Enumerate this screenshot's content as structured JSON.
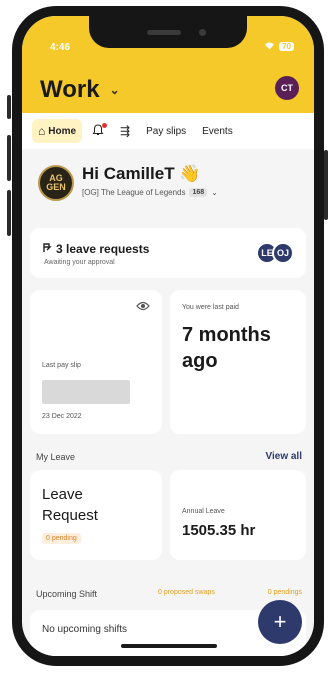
{
  "status": {
    "time": "4:46",
    "wifi": "wifi-icon",
    "battery": "70"
  },
  "header": {
    "workspace": "Work",
    "avatar_initials": "CT"
  },
  "tabs": [
    {
      "label": "Home",
      "icon": "home-icon"
    },
    {
      "label": "",
      "icon": "bell-icon"
    },
    {
      "label": "",
      "icon": "mention-icon"
    },
    {
      "label": "Pay slips",
      "icon": ""
    },
    {
      "label": "Events",
      "icon": ""
    }
  ],
  "greeting": {
    "hello": "Hi CamilleT",
    "emoji": "👋",
    "org_logo_text": "AG GEN",
    "org_name": "[OG] The League of Legends",
    "org_badge": "168"
  },
  "leave_requests": {
    "title": "3 leave requests",
    "subtitle": "Awaiting your approval",
    "avatars": [
      "LE",
      "OJ"
    ]
  },
  "payslip": {
    "label": "Last pay slip",
    "date": "23 Dec 2022"
  },
  "last_paid": {
    "label": "You were last paid",
    "value": "7 months ago"
  },
  "my_leave": {
    "section_title": "My Leave",
    "view_all": "View all",
    "request_title": "Leave Request",
    "pending": "0 pending",
    "annual_label": "Annual Leave",
    "annual_value": "1505.35 hr"
  },
  "shifts": {
    "section_title": "Upcoming Shift",
    "proposed_swaps": "0 proposed swaps",
    "pendings": "0 pendings",
    "empty_text": "No upcoming shifts"
  },
  "fab": {
    "label": "+"
  },
  "colors": {
    "header_yellow": "#f4c929",
    "navy": "#2d3a6b",
    "avatar_purple": "#5a1f57",
    "pending_orange": "#d9822b"
  }
}
